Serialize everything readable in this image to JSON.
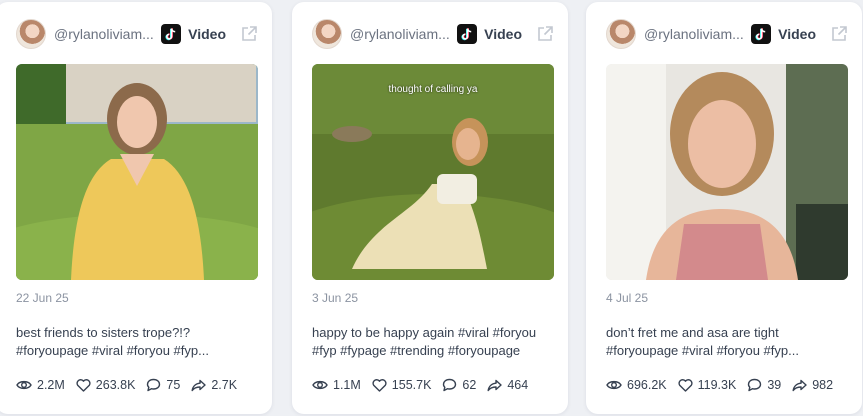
{
  "posts": [
    {
      "handle": "@rylanoliviam...",
      "platform": "Video",
      "thumbnail_text": "",
      "date": "22 Jun 25",
      "caption_line1": "best friends to sisters trope?!?",
      "caption_line2": "#foryoupage #viral #foryou #fyp...",
      "views": "2.2M",
      "likes": "263.8K",
      "comments": "75",
      "shares": "2.7K"
    },
    {
      "handle": "@rylanoliviam...",
      "platform": "Video",
      "thumbnail_text": "thought of calling ya",
      "date": "3 Jun 25",
      "caption_line1": "happy to be happy again #viral #foryou",
      "caption_line2": "#fyp #fypage #trending #foryoupage",
      "views": "1.1M",
      "likes": "155.7K",
      "comments": "62",
      "shares": "464"
    },
    {
      "handle": "@rylanoliviam...",
      "platform": "Video",
      "thumbnail_text": "",
      "date": "4 Jul 25",
      "caption_line1": "don’t fret me and asa are tight",
      "caption_line2": "#foryoupage #viral #foryou #fyp...",
      "views": "696.2K",
      "likes": "119.3K",
      "comments": "39",
      "shares": "982"
    }
  ],
  "icons": {
    "platform": "tiktok-icon",
    "external": "external-link-icon",
    "views": "eye-icon",
    "likes": "heart-icon",
    "comments": "comment-icon",
    "shares": "share-icon"
  },
  "colors": {
    "page_bg": "#eef0f4",
    "card_bg": "#ffffff",
    "muted_text": "#8b93a1",
    "body_text": "#374151"
  }
}
